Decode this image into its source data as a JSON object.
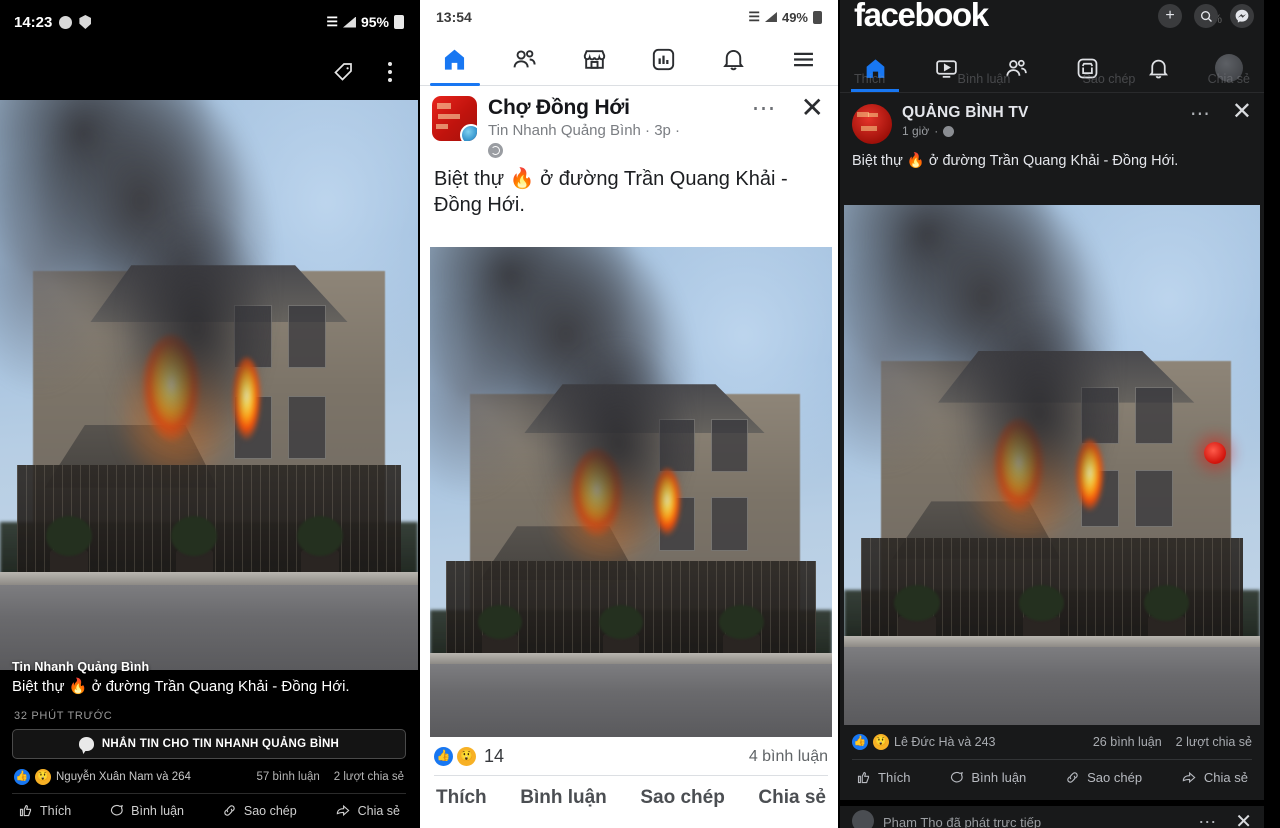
{
  "left_panel": {
    "status_bar": {
      "time": "14:23",
      "signal_label": "95%",
      "battery": "95%"
    },
    "toolbar": {
      "tag_icon": "tag-icon",
      "menu_icon": "overflow-menu-icon"
    },
    "overlay": {
      "page_name": "Tin Nhanh Quảng Bình",
      "caption": "Biệt thự 🔥 ở đường Trần Quang Khải - Đồng Hới."
    },
    "timestamp": "32 PHÚT TRƯỚC",
    "message_button": "NHẮN TIN CHO TIN NHANH QUẢNG BÌNH",
    "stats": {
      "reactors": "Nguyễn Xuân Nam và 264",
      "comments": "57 bình luận",
      "shares": "2 lượt chia sẻ"
    },
    "actions": [
      {
        "label": "Thích",
        "icon": "thumbs-up-icon"
      },
      {
        "label": "Bình luận",
        "icon": "comment-bubble-icon"
      },
      {
        "label": "Sao chép",
        "icon": "link-chain-icon"
      },
      {
        "label": "Chia sẻ",
        "icon": "share-arrow-icon"
      }
    ]
  },
  "middle_panel": {
    "status_bar": {
      "time": "13:54",
      "battery": "49%"
    },
    "nav": [
      {
        "name": "home",
        "icon": "home-icon",
        "active": true
      },
      {
        "name": "friends",
        "icon": "friends-icon",
        "active": false
      },
      {
        "name": "marketplace",
        "icon": "marketplace-icon",
        "active": false
      },
      {
        "name": "watch",
        "icon": "watch-icon",
        "active": false
      },
      {
        "name": "notifications",
        "icon": "bell-icon",
        "active": false
      },
      {
        "name": "menu",
        "icon": "hamburger-menu-icon",
        "active": false
      }
    ],
    "post": {
      "title": "Chợ Đồng Hới",
      "subtitle": "Tin Nhanh Quảng Bình · 3p ·",
      "privacy_icon": "globe-icon",
      "more_icon": "more-options-icon",
      "close_icon": "close-icon",
      "caption": "Biệt thự 🔥 ở đường Trần Quang Khải - Đồng Hới."
    },
    "engagement": {
      "reaction_count": "14",
      "comments": "4 bình luận"
    },
    "actions": [
      "Thích",
      "Bình luận",
      "Sao chép",
      "Chia sẻ"
    ]
  },
  "right_panel": {
    "brand": "facebook",
    "top_icons": [
      "plus-icon",
      "search-icon",
      "messenger-icon"
    ],
    "ghost_status": "91%",
    "nav": [
      {
        "name": "home",
        "icon": "home-icon",
        "active": true
      },
      {
        "name": "watch",
        "icon": "video-icon",
        "active": false
      },
      {
        "name": "friends",
        "icon": "friends-icon",
        "active": false
      },
      {
        "name": "marketplace",
        "icon": "marketplace-icon",
        "active": false
      },
      {
        "name": "notifications",
        "icon": "bell-icon",
        "active": false
      },
      {
        "name": "profile",
        "icon": "avatar-icon",
        "active": false
      }
    ],
    "ghost_actions": [
      "Thích",
      "Bình luận",
      "Sao chép",
      "Chia sẻ"
    ],
    "post": {
      "title": "QUẢNG BÌNH TV",
      "time": "1 giờ",
      "privacy_icon": "globe-icon",
      "more_icon": "more-options-icon",
      "close_icon": "close-icon",
      "caption": "Biệt thự 🔥 ở đường Trần Quang Khải - Đồng Hới."
    },
    "live_indicator": "live-record-dot",
    "stats": {
      "reactors": "Lê Đức Hà và 243",
      "comments": "26 bình luận",
      "shares": "2 lượt chia sẻ"
    },
    "actions": [
      {
        "label": "Thích",
        "icon": "thumbs-up-icon"
      },
      {
        "label": "Bình luận",
        "icon": "comment-bubble-icon"
      },
      {
        "label": "Sao chép",
        "icon": "link-chain-icon"
      },
      {
        "label": "Chia sẻ",
        "icon": "share-arrow-icon"
      }
    ],
    "next_post": {
      "author": "Phạm Thọ",
      "action": "đã phát trực tiếp"
    }
  },
  "colors": {
    "facebook_blue": "#1877f2",
    "dark_bg": "#18191a",
    "light_bg": "#ffffff",
    "live_red": "#d0120a"
  }
}
